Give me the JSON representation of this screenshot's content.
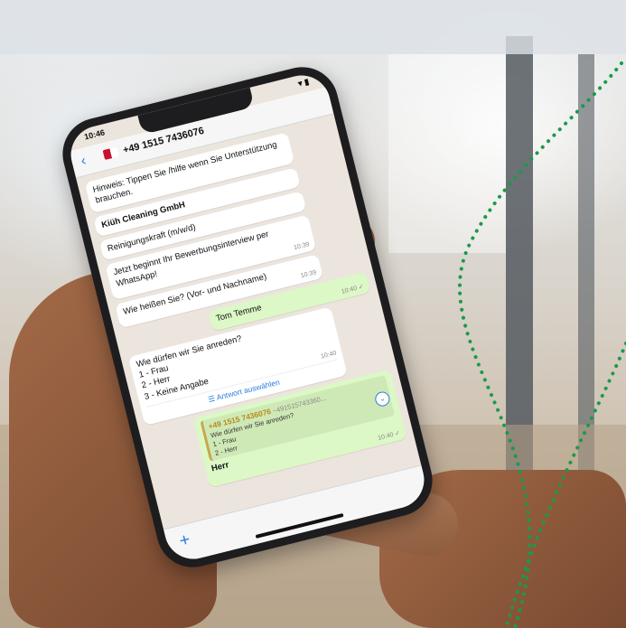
{
  "phone": {
    "status_time": "10:46",
    "status_icons": "▾ ▮",
    "contact_number": "+49 1515 7436076",
    "back_glyph": "‹",
    "compose_glyph": "+",
    "messages": {
      "hint": "Hinweis: Tippen Sie /hilfe wenn Sie Unterstützung brauchen.",
      "company": "Kiüh Cleaning GmbH",
      "job": "Reinigungskraft (m/w/d)",
      "intro": "Jetzt beginnt Ihr Bewerbungsinterview per WhatsApp!",
      "intro_time": "10:39",
      "ask_name": "Wie heißen Sie? (Vor- und Nachname)",
      "ask_name_time": "10:39",
      "reply_name": "Tom Temme",
      "reply_name_time": "10:40 ✓",
      "ask_salutation": "Wie dürfen wir Sie anreden?",
      "opt1": "1 - Frau",
      "opt2": "2 - Herr",
      "opt3": "3 - Keine Angabe",
      "ask_salutation_time": "10:40",
      "choose_answer": "☰ Antwort auswählen",
      "quote_sender": "+49 1515 7436076",
      "quote_sender_alt": "~491515743360...",
      "quote_line": "Wie dürfen wir Sie anreden?",
      "quote_opt1": "1 - Frau",
      "quote_opt2": "2 - Herr",
      "reply_choice_time": "10:40 ✓",
      "reply_choice": "Herr"
    }
  },
  "colors": {
    "accent_green": "#1a9a4a",
    "whatsapp_out": "#dcf8c6",
    "ios_blue": "#2a7de1"
  }
}
